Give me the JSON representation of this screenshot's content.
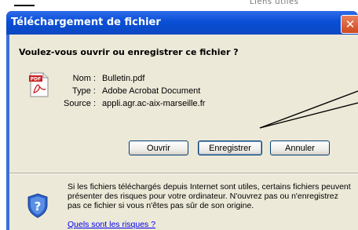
{
  "background_fragment": "Liens utiles",
  "dialog": {
    "title": "Téléchargement de fichier",
    "close_symbol": "✕",
    "question": "Voulez-vous ouvrir ou enregistrer ce fichier ?",
    "file": {
      "icon": "pdf-file-icon",
      "icon_label": "PDF",
      "name_label": "Nom :",
      "name_value": "Bulletin.pdf",
      "type_label": "Type :",
      "type_value": "Adobe Acrobat Document",
      "source_label": "Source :",
      "source_value": "appli.agr.ac-aix-marseille.fr"
    },
    "buttons": {
      "open": "Ouvrir",
      "save": "Enregistrer",
      "cancel": "Annuler"
    },
    "warning": {
      "icon": "security-shield-icon",
      "text": "Si les fichiers téléchargés depuis Internet sont utiles, certains fichiers peuvent présenter des risques pour votre ordinateur. N'ouvrez pas ou n'enregistrez pas ce fichier si vous n'êtes pas sûr de son origine.",
      "link": "Quels sont les risques ?"
    }
  },
  "colors": {
    "titlebar": "#0a4fd6",
    "close_button": "#d04a1e",
    "dialog_face": "#ece9d8",
    "link": "#0000ee"
  }
}
